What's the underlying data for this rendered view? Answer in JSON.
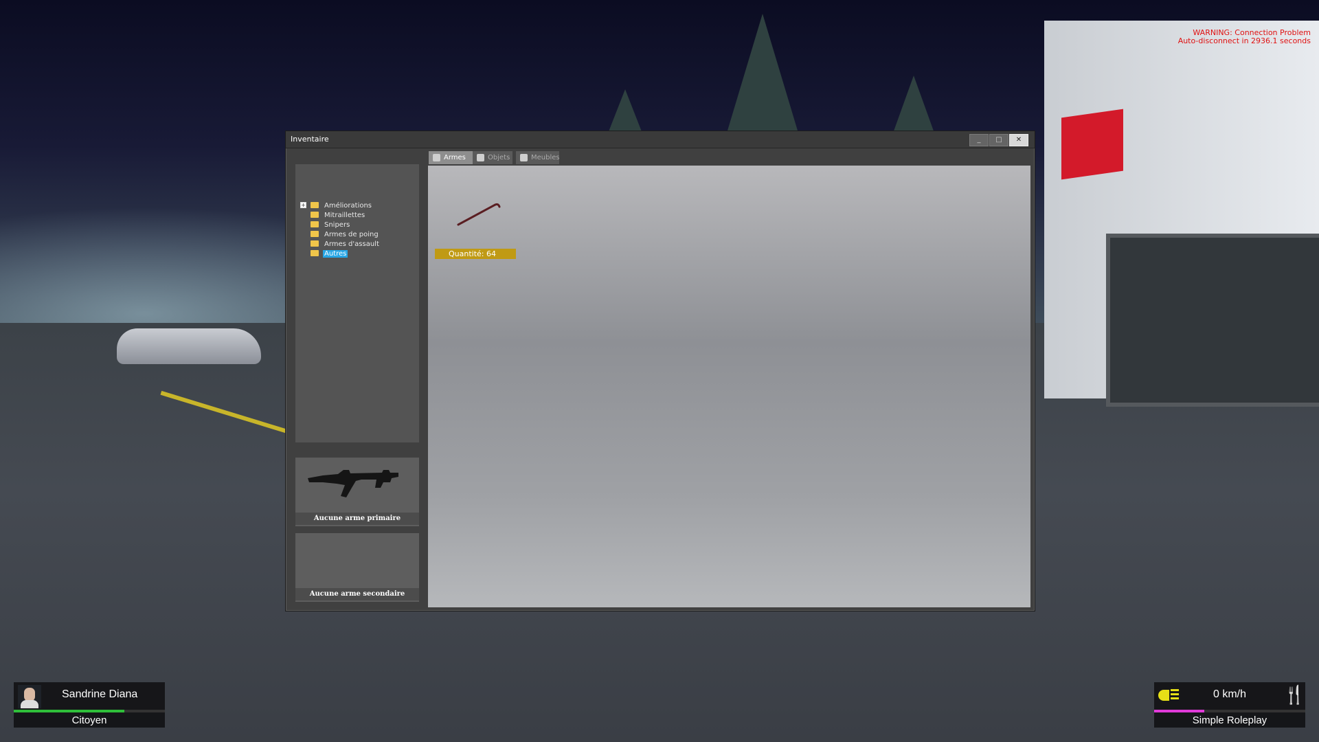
{
  "warning": {
    "line1": "WARNING: Connection Problem",
    "line2": "Auto-disconnect in 2936.1 seconds"
  },
  "window": {
    "title": "Inventaire",
    "buttons": {
      "minimize": "_",
      "maximize": "□",
      "close": "✕"
    }
  },
  "categories": [
    {
      "label": "Améliorations",
      "expandable": true
    },
    {
      "label": "Mitraillettes"
    },
    {
      "label": "Snipers"
    },
    {
      "label": "Armes de poing"
    },
    {
      "label": "Armes d'assault"
    },
    {
      "label": "Autres",
      "selected": true
    }
  ],
  "tabs": [
    {
      "label": "Armes",
      "active": true
    },
    {
      "label": "Objets"
    },
    {
      "label": "Meubles"
    }
  ],
  "slots": {
    "primary": "Aucune arme primaire",
    "secondary": "Aucune arme secondaire"
  },
  "items": [
    {
      "icon": "crowbar-icon",
      "quantity_label": "Quantité: 64"
    }
  ],
  "hud": {
    "player_name": "Sandrine Diana",
    "job": "Citoyen",
    "health_fraction": 0.73,
    "speed": "0 km/h",
    "server": "Simple Roleplay",
    "hunger_fraction": 0.33,
    "colors": {
      "health": "#2fbf3a",
      "hunger": "#e03ad8",
      "accent": "#27a6e6",
      "quantity": "#c09a14"
    }
  }
}
